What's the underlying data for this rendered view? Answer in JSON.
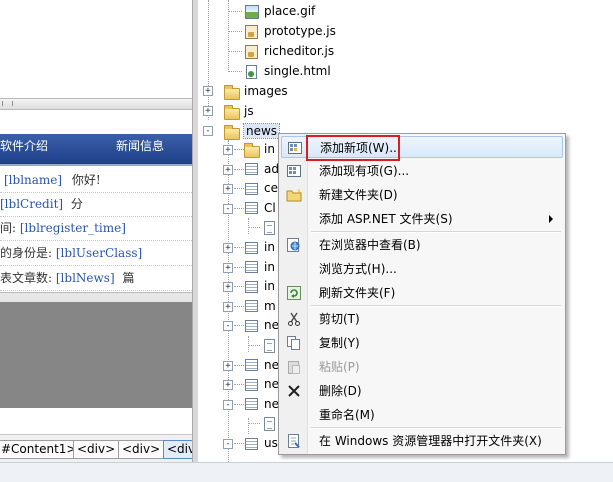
{
  "designer": {
    "nav_tabs": [
      "软件介绍",
      "新闻信息"
    ],
    "info_rows": [
      {
        "label": "",
        "control": "[lblname]",
        "suffix": "你好!"
      },
      {
        "label": "",
        "control": "[lblCredit]",
        "suffix": "分"
      },
      {
        "label": "间:",
        "control": "[lblregister_time]",
        "suffix": ""
      },
      {
        "label": "的身份是:",
        "control": "[lblUserClass]",
        "suffix": ""
      },
      {
        "label": "表文章数:",
        "control": "[lblNews]",
        "suffix": "篇"
      }
    ],
    "tag_breadcrumb": [
      "#Content1>",
      "<div>",
      "<div>",
      "<div>"
    ]
  },
  "explorer": {
    "files_top": [
      {
        "name": "place.gif",
        "icon": "image-file-icon"
      },
      {
        "name": "prototype.js",
        "icon": "js-file-icon"
      },
      {
        "name": "richeditor.js",
        "icon": "js-file-icon"
      },
      {
        "name": "single.html",
        "icon": "html-file-icon"
      }
    ],
    "folders": [
      {
        "name": "images",
        "expander": "+"
      },
      {
        "name": "js",
        "expander": "+"
      },
      {
        "name": "news",
        "expander": "-"
      }
    ],
    "children": [
      {
        "name": "in",
        "icon": "folder-icon",
        "expander": "+"
      },
      {
        "name": "ad",
        "icon": "page-icon",
        "expander": "+"
      },
      {
        "name": "ce",
        "icon": "page-icon",
        "expander": "+"
      },
      {
        "name": "Cl",
        "icon": "page-icon",
        "expander": "-"
      },
      {
        "name": "",
        "icon": "codebehind-icon",
        "expander": ""
      },
      {
        "name": "in",
        "icon": "page-icon",
        "expander": "+"
      },
      {
        "name": "in",
        "icon": "page-icon",
        "expander": "+"
      },
      {
        "name": "in",
        "icon": "page-icon",
        "expander": "+"
      },
      {
        "name": "m",
        "icon": "page-icon",
        "expander": "+"
      },
      {
        "name": "ne",
        "icon": "page-icon",
        "expander": "-"
      },
      {
        "name": "",
        "icon": "codebehind-icon",
        "expander": ""
      },
      {
        "name": "ne",
        "icon": "page-icon",
        "expander": "+"
      },
      {
        "name": "ne",
        "icon": "page-icon",
        "expander": "+"
      },
      {
        "name": "ne",
        "icon": "page-icon",
        "expander": "-"
      },
      {
        "name": "",
        "icon": "codebehind-icon",
        "expander": ""
      },
      {
        "name": "us",
        "icon": "page-icon",
        "expander": "-"
      }
    ]
  },
  "context_menu": {
    "items": [
      {
        "label": "添加新项(W)...",
        "icon": "add-new-item-icon",
        "state": "hover"
      },
      {
        "label": "添加现有项(G)...",
        "icon": "add-existing-item-icon",
        "state": "normal"
      },
      {
        "label": "新建文件夹(D)",
        "icon": "new-folder-icon",
        "state": "normal"
      },
      {
        "label": "添加 ASP.NET 文件夹(S)",
        "icon": "",
        "state": "submenu"
      },
      {
        "label": "在浏览器中查看(B)",
        "icon": "view-in-browser-icon",
        "state": "normal"
      },
      {
        "label": "浏览方式(H)...",
        "icon": "",
        "state": "normal"
      },
      {
        "label": "刷新文件夹(F)",
        "icon": "refresh-icon",
        "state": "normal"
      },
      {
        "label": "剪切(T)",
        "icon": "cut-icon",
        "state": "normal"
      },
      {
        "label": "复制(Y)",
        "icon": "copy-icon",
        "state": "normal"
      },
      {
        "label": "粘贴(P)",
        "icon": "paste-icon",
        "state": "disabled"
      },
      {
        "label": "删除(D)",
        "icon": "delete-icon",
        "state": "normal"
      },
      {
        "label": "重命名(M)",
        "icon": "",
        "state": "normal"
      },
      {
        "label": "在 Windows 资源管理器中打开文件夹(X)",
        "icon": "open-in-explorer-icon",
        "state": "normal"
      }
    ],
    "highlight_color": "#d81e1e"
  }
}
